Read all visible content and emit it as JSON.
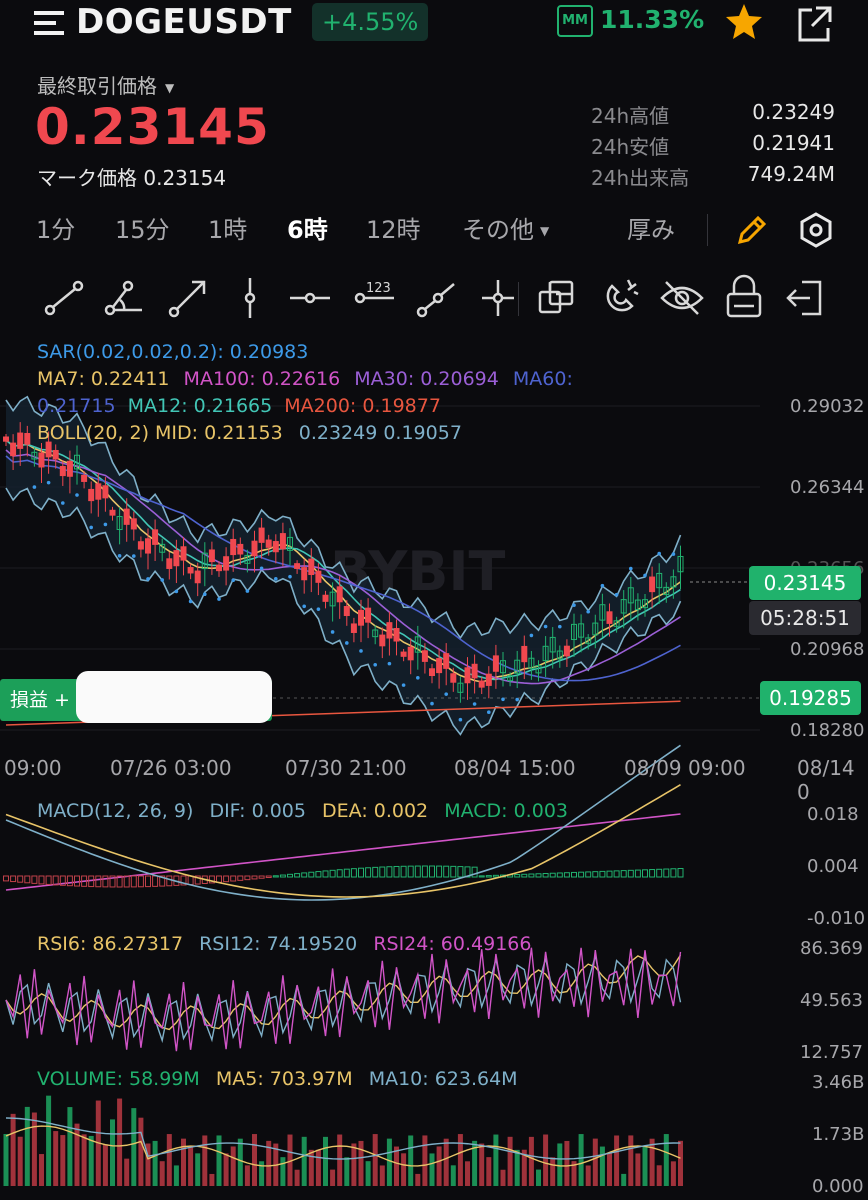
{
  "header": {
    "symbol": "DOGEUSDT",
    "change_pct": "+4.55%",
    "mm_label": "MM",
    "mm_value": "11.33%"
  },
  "price": {
    "label": "最終取引価格",
    "last": "0.23145",
    "mark_label": "マーク価格",
    "mark_value": "0.23154"
  },
  "stats": [
    {
      "key": "24h高値",
      "value": "0.23249"
    },
    {
      "key": "24h安値",
      "value": "0.21941"
    },
    {
      "key": "24h出来高",
      "value": "749.24M"
    }
  ],
  "intervals": [
    {
      "label": "1分",
      "active": false
    },
    {
      "label": "15分",
      "active": false
    },
    {
      "label": "1時",
      "active": false
    },
    {
      "label": "6時",
      "active": true
    },
    {
      "label": "12時",
      "active": false
    },
    {
      "label": "その他",
      "active": false
    },
    {
      "label": "厚み",
      "active": false
    }
  ],
  "tools": [
    "trend-line-icon",
    "angle-line-icon",
    "arrow-line-icon",
    "vertical-line-icon",
    "horizontal-line-icon",
    "price-label-icon",
    "ray-icon",
    "crosshair-icon",
    "layers-icon",
    "magnet-icon",
    "hide-icon",
    "lock-icon",
    "exit-icon"
  ],
  "tool_badge": "123",
  "indicators": {
    "sar": "SAR(0.02,0.02,0.2): 0.20983",
    "ma7": "MA7: 0.22411",
    "ma100": "MA100: 0.22616",
    "ma30": "MA30: 0.20694",
    "ma60_label": "MA60:",
    "ma60_value": "0.21715",
    "ma12": "MA12: 0.21665",
    "ma200": "MA200: 0.19877",
    "boll": "BOLL(20, 2) MID: 0.21153",
    "boll_bands": "0.23249 0.19057"
  },
  "price_axis": [
    "0.29032",
    "0.26344",
    "0.23656",
    "0.20968",
    "0.18280"
  ],
  "price_tags": {
    "last": "0.23145",
    "countdown": "05:28:51",
    "position": "0.19285"
  },
  "pnl_label": "損益 +",
  "time_axis": [
    "09:00",
    "07/26 03:00",
    "07/30 21:00",
    "08/04 15:00",
    "08/09 09:00",
    "08/14 0"
  ],
  "macd": {
    "title": "MACD(12, 26, 9)",
    "dif": "DIF: 0.005",
    "dea": "DEA: 0.002",
    "macd": "MACD: 0.003",
    "axis": [
      "0.018",
      "0.004",
      "-0.010"
    ]
  },
  "rsi": {
    "rsi6": "RSI6: 86.27317",
    "rsi12": "RSI12: 74.19520",
    "rsi24": "RSI24: 60.49166",
    "axis": [
      "86.369",
      "49.563",
      "12.757"
    ]
  },
  "volume": {
    "vol": "VOLUME: 58.99M",
    "ma5": "MA5: 703.97M",
    "ma10": "MA10: 623.64M",
    "axis": [
      "3.46B",
      "1.73B",
      "0.000"
    ]
  },
  "watermark": "BYBIT",
  "colors": {
    "up": "#21b26f",
    "down": "#f0484f",
    "accent": "#f7a600",
    "sar": "#3d9ae8",
    "ma7": "#e8c468",
    "ma12": "#42c6b6",
    "ma30": "#9b5fd6",
    "ma60": "#4e63cf",
    "ma100": "#d154c7",
    "ma200": "#e8563f",
    "boll": "#7fb0c9"
  }
}
